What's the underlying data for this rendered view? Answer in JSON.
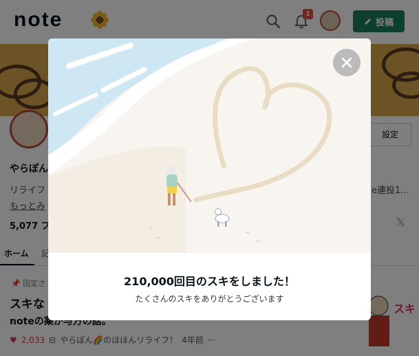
{
  "header": {
    "logo_text": "note",
    "notification_count": "1",
    "post_button_label": "投稿",
    "icons": [
      "sunflower-icon",
      "search-icon",
      "bell-icon",
      "avatar",
      "pencil-icon"
    ]
  },
  "profile": {
    "name": "やらぽん",
    "description_visible": "リライフ",
    "description_right": "e連投1...",
    "more_link": "もっとみ",
    "followers": "5,077 フ",
    "settings_button": "設定",
    "x_icon_label": "𝕏"
  },
  "tabs": {
    "home": "ホーム",
    "second": "記"
  },
  "article": {
    "pin_label": "固定さ",
    "title_line1": "スキな",
    "title_line2": "noteの薬が与方の話。",
    "like_count": "2,033",
    "author": "やらぽん🌈のほほんリライフ！",
    "age": "4年前",
    "more": "···"
  },
  "modal": {
    "title": "210,000回目のスキをしました！",
    "subtitle": "たくさんのスキをありがとうございます",
    "close_label": "×"
  },
  "side_illustration": {
    "text": "スキ!!"
  },
  "colors": {
    "brand_green": "#1b7f5f",
    "like_red": "#d33b55",
    "badge_red": "#e05343",
    "sand": "#f8f4ef",
    "sea": "#cfe6f3"
  }
}
